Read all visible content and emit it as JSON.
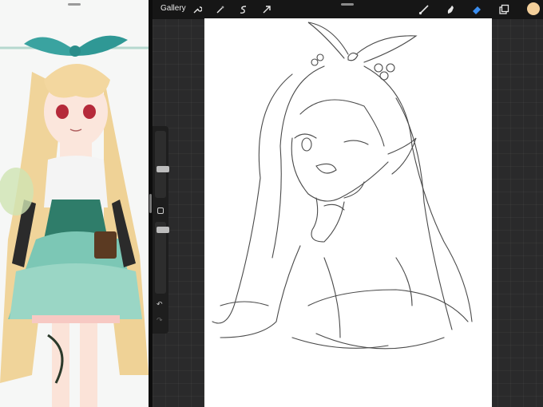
{
  "topbar": {
    "gallery_label": "Gallery",
    "left_tools": [
      "wrench-icon",
      "magic-wand-icon",
      "selection-icon",
      "transform-arrow-icon"
    ],
    "right_tools": [
      "brush-icon",
      "smudge-icon",
      "eraser-icon",
      "layers-icon"
    ],
    "active_tool": "eraser-icon",
    "active_color": "#f3cf9a",
    "active_tool_color": "#3b8ef0"
  },
  "sidebar": {
    "controls": [
      "brush-size-slider",
      "modify-button",
      "opacity-slider",
      "undo-icon",
      "redo-icon"
    ],
    "undo_glyph": "↶",
    "redo_glyph": "↷"
  }
}
